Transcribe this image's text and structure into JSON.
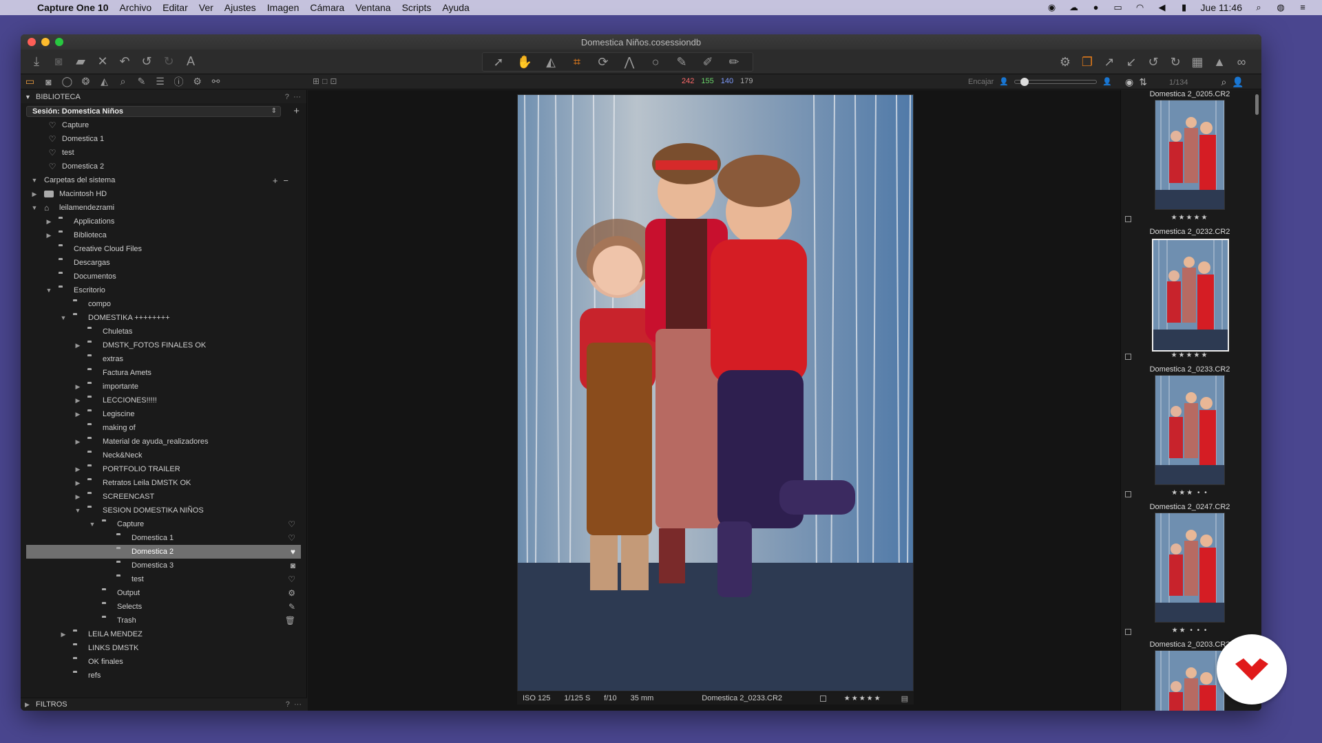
{
  "menubar": {
    "app_name": "Capture One 10",
    "items": [
      "Archivo",
      "Editar",
      "Ver",
      "Ajustes",
      "Imagen",
      "Cámara",
      "Ventana",
      "Scripts",
      "Ayuda"
    ],
    "clock": "Jue 11:46"
  },
  "window": {
    "title": "Domestica Niños.cosessiondb"
  },
  "readout": {
    "r": "242",
    "g": "155",
    "b": "140",
    "l": "179"
  },
  "colors": {
    "r": "#ff6b6b",
    "g": "#6ad46a",
    "b": "#7f9cff",
    "l": "#aaaaaa",
    "accent": "#e07a1c",
    "selected_row": "#6f6f6f"
  },
  "viewer_bar": {
    "fit_label": "Encajar"
  },
  "browser_bar": {
    "count": "1/134"
  },
  "library": {
    "title": "BIBLIOTECA",
    "help": "?",
    "more": "···",
    "session_label": "Sesión: Domestica Niños",
    "favorites": [
      "Capture",
      "Domestica 1",
      "test",
      "Domestica 2"
    ],
    "system_folders_label": "Carpetas del sistema",
    "tree": [
      {
        "label": "Macintosh HD",
        "level": 0,
        "chev": "right",
        "icon": "disk"
      },
      {
        "label": "leilamendezrami",
        "level": 0,
        "chev": "down",
        "icon": "home"
      },
      {
        "label": "Applications",
        "level": 1,
        "chev": "right",
        "icon": "folder"
      },
      {
        "label": "Biblioteca",
        "level": 1,
        "chev": "right",
        "icon": "folder"
      },
      {
        "label": "Creative Cloud Files",
        "level": 1,
        "chev": "",
        "icon": "folder"
      },
      {
        "label": "Descargas",
        "level": 1,
        "chev": "",
        "icon": "folder"
      },
      {
        "label": "Documentos",
        "level": 1,
        "chev": "",
        "icon": "folder"
      },
      {
        "label": "Escritorio",
        "level": 1,
        "chev": "down",
        "icon": "folder"
      },
      {
        "label": "compo",
        "level": 2,
        "chev": "",
        "icon": "folder"
      },
      {
        "label": "DOMESTIKA ++++++++",
        "level": 2,
        "chev": "down",
        "icon": "folder"
      },
      {
        "label": "Chuletas",
        "level": 3,
        "chev": "",
        "icon": "folder"
      },
      {
        "label": "DMSTK_FOTOS FINALES OK",
        "level": 3,
        "chev": "right",
        "icon": "folder"
      },
      {
        "label": "extras",
        "level": 3,
        "chev": "",
        "icon": "folder"
      },
      {
        "label": "Factura Amets",
        "level": 3,
        "chev": "",
        "icon": "folder"
      },
      {
        "label": "importante",
        "level": 3,
        "chev": "right",
        "icon": "folder"
      },
      {
        "label": "LECCIONES!!!!!",
        "level": 3,
        "chev": "right",
        "icon": "folder"
      },
      {
        "label": "Legiscine",
        "level": 3,
        "chev": "right",
        "icon": "folder"
      },
      {
        "label": "making of",
        "level": 3,
        "chev": "",
        "icon": "folder"
      },
      {
        "label": "Material de ayuda_realizadores",
        "level": 3,
        "chev": "right",
        "icon": "folder"
      },
      {
        "label": "Neck&Neck",
        "level": 3,
        "chev": "",
        "icon": "folder"
      },
      {
        "label": "PORTFOLIO TRAILER",
        "level": 3,
        "chev": "right",
        "icon": "folder"
      },
      {
        "label": "Retratos Leila DMSTK OK",
        "level": 3,
        "chev": "right",
        "icon": "folder"
      },
      {
        "label": "SCREENCAST",
        "level": 3,
        "chev": "right",
        "icon": "folder"
      },
      {
        "label": "SESION DOMESTIKA NIÑOS",
        "level": 3,
        "chev": "down",
        "icon": "folder"
      },
      {
        "label": "Capture",
        "level": 4,
        "chev": "down",
        "icon": "folder",
        "right": "heart"
      },
      {
        "label": "Domestica 1",
        "level": 5,
        "chev": "",
        "icon": "folder",
        "right": "heart"
      },
      {
        "label": "Domestica 2",
        "level": 5,
        "chev": "",
        "icon": "folder",
        "right": "heart-filled",
        "selected": true
      },
      {
        "label": "Domestica 3",
        "level": 5,
        "chev": "",
        "icon": "folder",
        "right": "camera"
      },
      {
        "label": "test",
        "level": 5,
        "chev": "",
        "icon": "folder",
        "right": "heart"
      },
      {
        "label": "Output",
        "level": 4,
        "chev": "",
        "icon": "folder",
        "right": "gear"
      },
      {
        "label": "Selects",
        "level": 4,
        "chev": "",
        "icon": "folder",
        "right": "selects"
      },
      {
        "label": "Trash",
        "level": 4,
        "chev": "",
        "icon": "folder",
        "right": "trash"
      },
      {
        "label": "LEILA MENDEZ",
        "level": 2,
        "chev": "right",
        "icon": "folder"
      },
      {
        "label": "LINKS DMSTK",
        "level": 2,
        "chev": "",
        "icon": "folder"
      },
      {
        "label": "OK finales",
        "level": 2,
        "chev": "",
        "icon": "folder"
      },
      {
        "label": "refs",
        "level": 2,
        "chev": "",
        "icon": "folder"
      }
    ],
    "filters_label": "FILTROS"
  },
  "photo": {
    "iso": "ISO 125",
    "shutter": "1/125 S",
    "aperture": "f/10",
    "focal": "35 mm",
    "filename": "Domestica 2_0233.CR2",
    "stars": "★★★★★"
  },
  "browser": {
    "thumbnails": [
      {
        "name": "Domestica 2_0205.CR2",
        "rating": 5,
        "stars": "★★★★★",
        "selected": false
      },
      {
        "name": "Domestica 2_0232.CR2",
        "rating": 5,
        "stars": "★★★★★",
        "selected": true
      },
      {
        "name": "Domestica 2_0233.CR2",
        "rating": 3,
        "stars": "★★★ • •",
        "selected": false
      },
      {
        "name": "Domestica 2_0247.CR2",
        "rating": 2,
        "stars": "★★ • • •",
        "selected": false
      },
      {
        "name": "Domestica 2_0203.CR2",
        "rating": null,
        "stars": "",
        "selected": false
      }
    ]
  }
}
